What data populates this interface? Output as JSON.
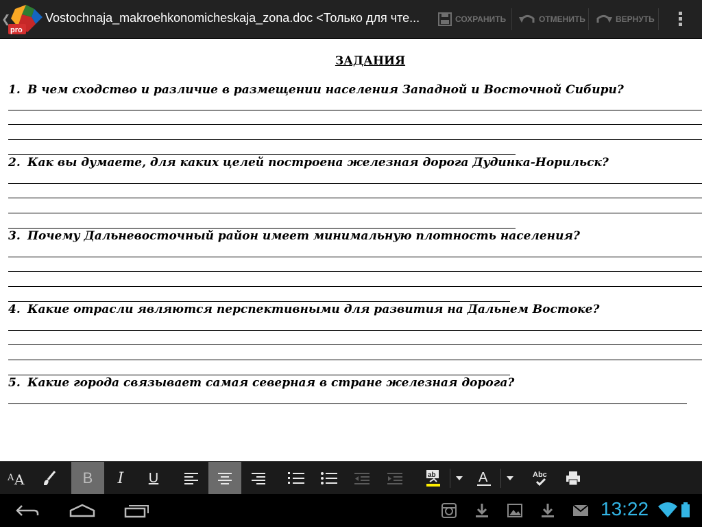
{
  "window": {
    "document_title": "Vostochnaja_makroehkonomicheskaja_zona.doc <Только для чте...",
    "app_badge": "pro"
  },
  "actionbar": {
    "save_label": "СОХРАНИТЬ",
    "undo_label": "ОТМЕНИТЬ",
    "redo_label": "ВЕРНУТЬ"
  },
  "document": {
    "heading": "ЗАДАНИЯ",
    "questions": [
      {
        "number": "1.",
        "text": "В чем сходство и различие  в размещении населения Западной и Восточной Сибири?"
      },
      {
        "number": "2.",
        "text": "Как вы думаете, для каких целей построена железная дорога Дудинка-Норильск?"
      },
      {
        "number": "3.",
        "text": "Почему Дальневосточный район имеет минимальную плотность населения?"
      },
      {
        "number": "4.",
        "text": "Какие отрасли являются перспективными для развития на Дальнем Востоке?"
      },
      {
        "number": "5.",
        "text": "Какие города связывает самая северная в стране железная дорога?"
      }
    ]
  },
  "toolbar": {
    "bold_label": "B",
    "italic_label": "I",
    "underline_label": "U",
    "font_color_label": "A",
    "spellcheck_label": "Abc",
    "highlight_label": "ab",
    "font_style_label": "A",
    "highlight_color": "#ffee00",
    "active_buttons": [
      "bold",
      "align-center"
    ]
  },
  "system": {
    "clock": "13:22",
    "clock_color": "#33b5e5"
  }
}
